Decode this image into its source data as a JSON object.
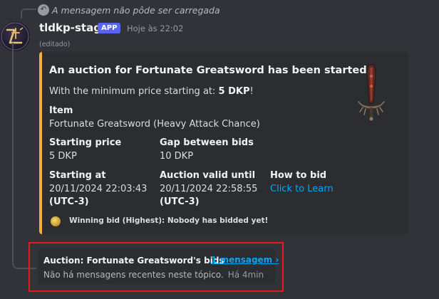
{
  "reply": {
    "icon": "reply-arrow-icon",
    "text": "A mensagem não pôde ser carregada"
  },
  "message": {
    "author": "tldkp-stage",
    "badge": "APP",
    "timestamp": "Hoje às 22:02",
    "edited": "(editado)",
    "avatar_icon": "guild-logo-avatar"
  },
  "embed": {
    "accent_color": "#f0b232",
    "title": "An auction for Fortunate Greatsword has been started!",
    "description_prefix": "With the minimum price starting at: ",
    "description_value": "5 DKP",
    "description_suffix": "!",
    "fields": {
      "item": {
        "name": "Item",
        "value": "Fortunate Greatsword (Heavy Attack Chance)"
      },
      "starting_price": {
        "name": "Starting price",
        "value": "5 DKP"
      },
      "gap": {
        "name": "Gap between bids",
        "value": "10 DKP"
      },
      "starting_at": {
        "name": "Starting at",
        "value": "20/11/2024 22:03:43",
        "tz": "(UTC-3)"
      },
      "valid_until": {
        "name": "Auction valid until",
        "value": "20/11/2024 22:58:55",
        "tz": "(UTC-3)"
      },
      "how_to_bid": {
        "name": "How to bid",
        "link": "Click to Learn"
      }
    },
    "thumbnail_icon": "greatsword-icon",
    "footer": {
      "icon": "coin-icon",
      "text": "Winning bid (Highest): Nobody has bidded yet!"
    }
  },
  "thread": {
    "name": "Auction: Fortunate Greatsword's bids",
    "count_link": "1 mensagem ›",
    "preview": "Não há mensagens recentes neste tópico.",
    "ago": "Há 4min",
    "highlight_color": "#e31b1b"
  }
}
